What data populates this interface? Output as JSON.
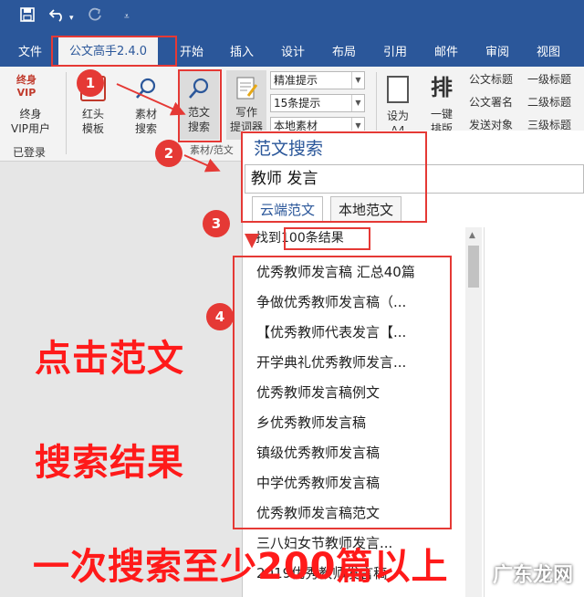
{
  "quick_access": {
    "save_icon": "save-icon",
    "undo_icon": "undo-icon",
    "redo_icon": "redo-icon",
    "customize_icon": "customize-icon"
  },
  "menu": {
    "items": [
      "文件",
      "公文高手2.4.0",
      "开始",
      "插入",
      "设计",
      "布局",
      "引用",
      "邮件",
      "审阅",
      "视图"
    ],
    "active_index": 1
  },
  "ribbon": {
    "vip": {
      "badge": "终身\nVIP",
      "label_1": "终身",
      "label_2": "VIP用户",
      "status": "已登录"
    },
    "red_template": {
      "label_1": "红头",
      "label_2": "模板"
    },
    "material_search": {
      "label_1": "素材",
      "label_2": "搜索"
    },
    "sample_search": {
      "label_1": "范文",
      "label_2": "搜索"
    },
    "writing": {
      "label_1": "写作",
      "label_2": "提词器"
    },
    "group_label": "素材/范文",
    "dropdowns": [
      "精准提示",
      "15条提示",
      "本地素材"
    ],
    "set_a4": {
      "label_1": "设为",
      "label_2": "A4"
    },
    "typeset": {
      "glyph": "排",
      "label_1": "一键",
      "label_2": "排版"
    },
    "doc_styles": [
      "公文标题",
      "公文署名",
      "发送对象"
    ],
    "heading_styles": [
      "一级标题",
      "二级标题",
      "三级标题"
    ]
  },
  "panel": {
    "title": "范文搜索",
    "search_value": "教师 发言",
    "tabs": [
      "云端范文",
      "本地范文"
    ],
    "active_tab": 0,
    "result_prefix": "找到",
    "result_count": "100条结果",
    "results": [
      "优秀教师发言稿 汇总40篇",
      "争做优秀教师发言稿（...",
      "【优秀教师代表发言【...",
      "开学典礼优秀教师发言...",
      "优秀教师发言稿例文",
      "乡优秀教师发言稿",
      "镇级优秀教师发言稿",
      "中学优秀教师发言稿",
      "优秀教师发言稿范文",
      "三八妇女节教师发言...",
      "2019优秀教师发言稿"
    ]
  },
  "annotations": {
    "steps": [
      "1",
      "2",
      "3",
      "4"
    ],
    "text_1": "点击范文",
    "text_2": "搜索结果",
    "text_3": "一次搜索至少200篇以上"
  },
  "watermark": "广东龙网",
  "colors": {
    "accent": "#2b579a",
    "annotation_red": "#e53935"
  }
}
